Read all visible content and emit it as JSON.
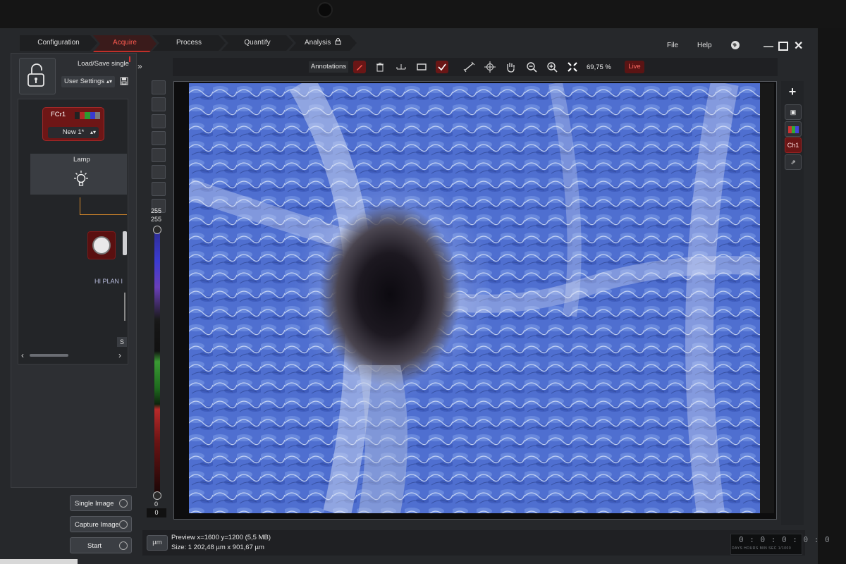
{
  "workflow_tabs": [
    {
      "label": "Configuration",
      "active": false
    },
    {
      "label": "Acquire",
      "active": true
    },
    {
      "label": "Process",
      "active": false
    },
    {
      "label": "Quantify",
      "active": false
    },
    {
      "label": "Analysis",
      "active": false
    }
  ],
  "menu": {
    "file": "File",
    "help": "Help"
  },
  "left_panel": {
    "load_save_label": "Load/Save single",
    "user_settings": "User Settings",
    "fcr_label": "FCr1",
    "new_select": "New 1*",
    "lamp_label": "Lamp",
    "objective_label": "HI PLAN I",
    "s_label": "S"
  },
  "actions": {
    "single_image": "Single Image",
    "capture_image": "Capture Image",
    "start": "Start"
  },
  "toolbar": {
    "annotations": "Annotations",
    "zoom": "69,75 %",
    "live": "Live"
  },
  "lut": {
    "top_max": "255",
    "top_min": "255",
    "bottom_max": "0",
    "bottom_min": "0"
  },
  "right_tools": {
    "channel": "Ch1"
  },
  "status": {
    "unit_button": "µm",
    "preview": "Preview x=1600 y=1200  (5,5 MB)",
    "size": "Size: 1 202,48 µm x 901,67 µm"
  },
  "timer": {
    "value": "0 : 0 : 0 : 0 : 0",
    "units": "DAYS HOURS MIN SEC 1/1000"
  },
  "colors": {
    "accent_red": "#c0302a",
    "live_red": "#ff6b63",
    "image_blue": "#4f6ed0"
  }
}
